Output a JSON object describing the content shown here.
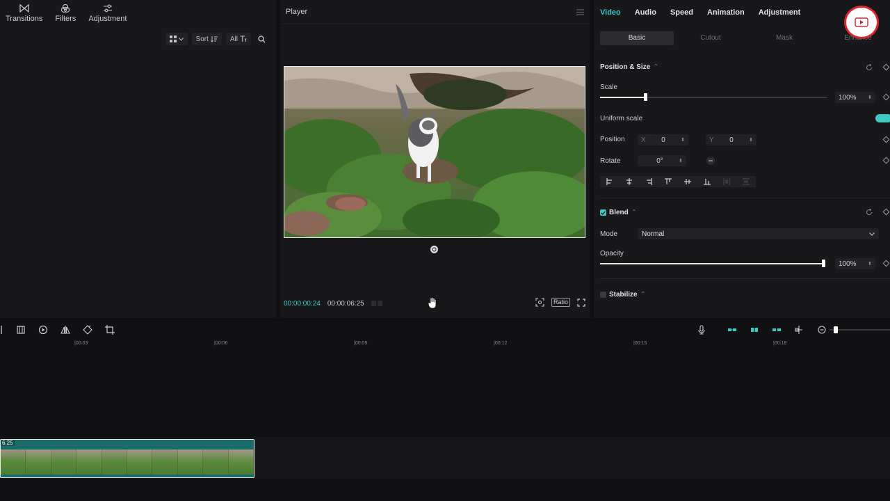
{
  "left_toolbar": {
    "items": [
      {
        "label": "Transitions",
        "icon": "transitions-icon"
      },
      {
        "label": "Filters",
        "icon": "filters-icon"
      },
      {
        "label": "Adjustment",
        "icon": "adjustment-icon"
      }
    ]
  },
  "library": {
    "sort_label": "Sort",
    "filter_label": "All"
  },
  "player": {
    "title": "Player",
    "current_time": "00:00:00:24",
    "total_time": "00:00:06:25",
    "ratio_label": "Ratio"
  },
  "inspector": {
    "tabs": [
      "Video",
      "Audio",
      "Speed",
      "Animation",
      "Adjustment"
    ],
    "active_tab": "Video",
    "sub_tabs": [
      "Basic",
      "Cutout",
      "Mask",
      "Enhance"
    ],
    "active_sub_tab": "Basic",
    "position_size": {
      "title": "Position & Size",
      "scale_label": "Scale",
      "scale_value": "100%",
      "uniform_scale_label": "Uniform scale",
      "position_label": "Position",
      "x_label": "X",
      "x_value": "0",
      "y_label": "Y",
      "y_value": "0",
      "rotate_label": "Rotate",
      "rotate_value": "0°"
    },
    "blend": {
      "title": "Blend",
      "mode_label": "Mode",
      "mode_value": "Normal",
      "opacity_label": "Opacity",
      "opacity_value": "100%"
    },
    "stabilize": {
      "title": "Stabilize"
    }
  },
  "timeline": {
    "ruler_ticks": [
      "|00:03",
      "|00:06",
      "|00:09",
      "|00:12",
      "|00:15",
      "|00:18"
    ],
    "clip_label": "6.25"
  },
  "colors": {
    "accent": "#3fc9c4",
    "panel": "#18181b",
    "record_red": "#d8262e"
  }
}
